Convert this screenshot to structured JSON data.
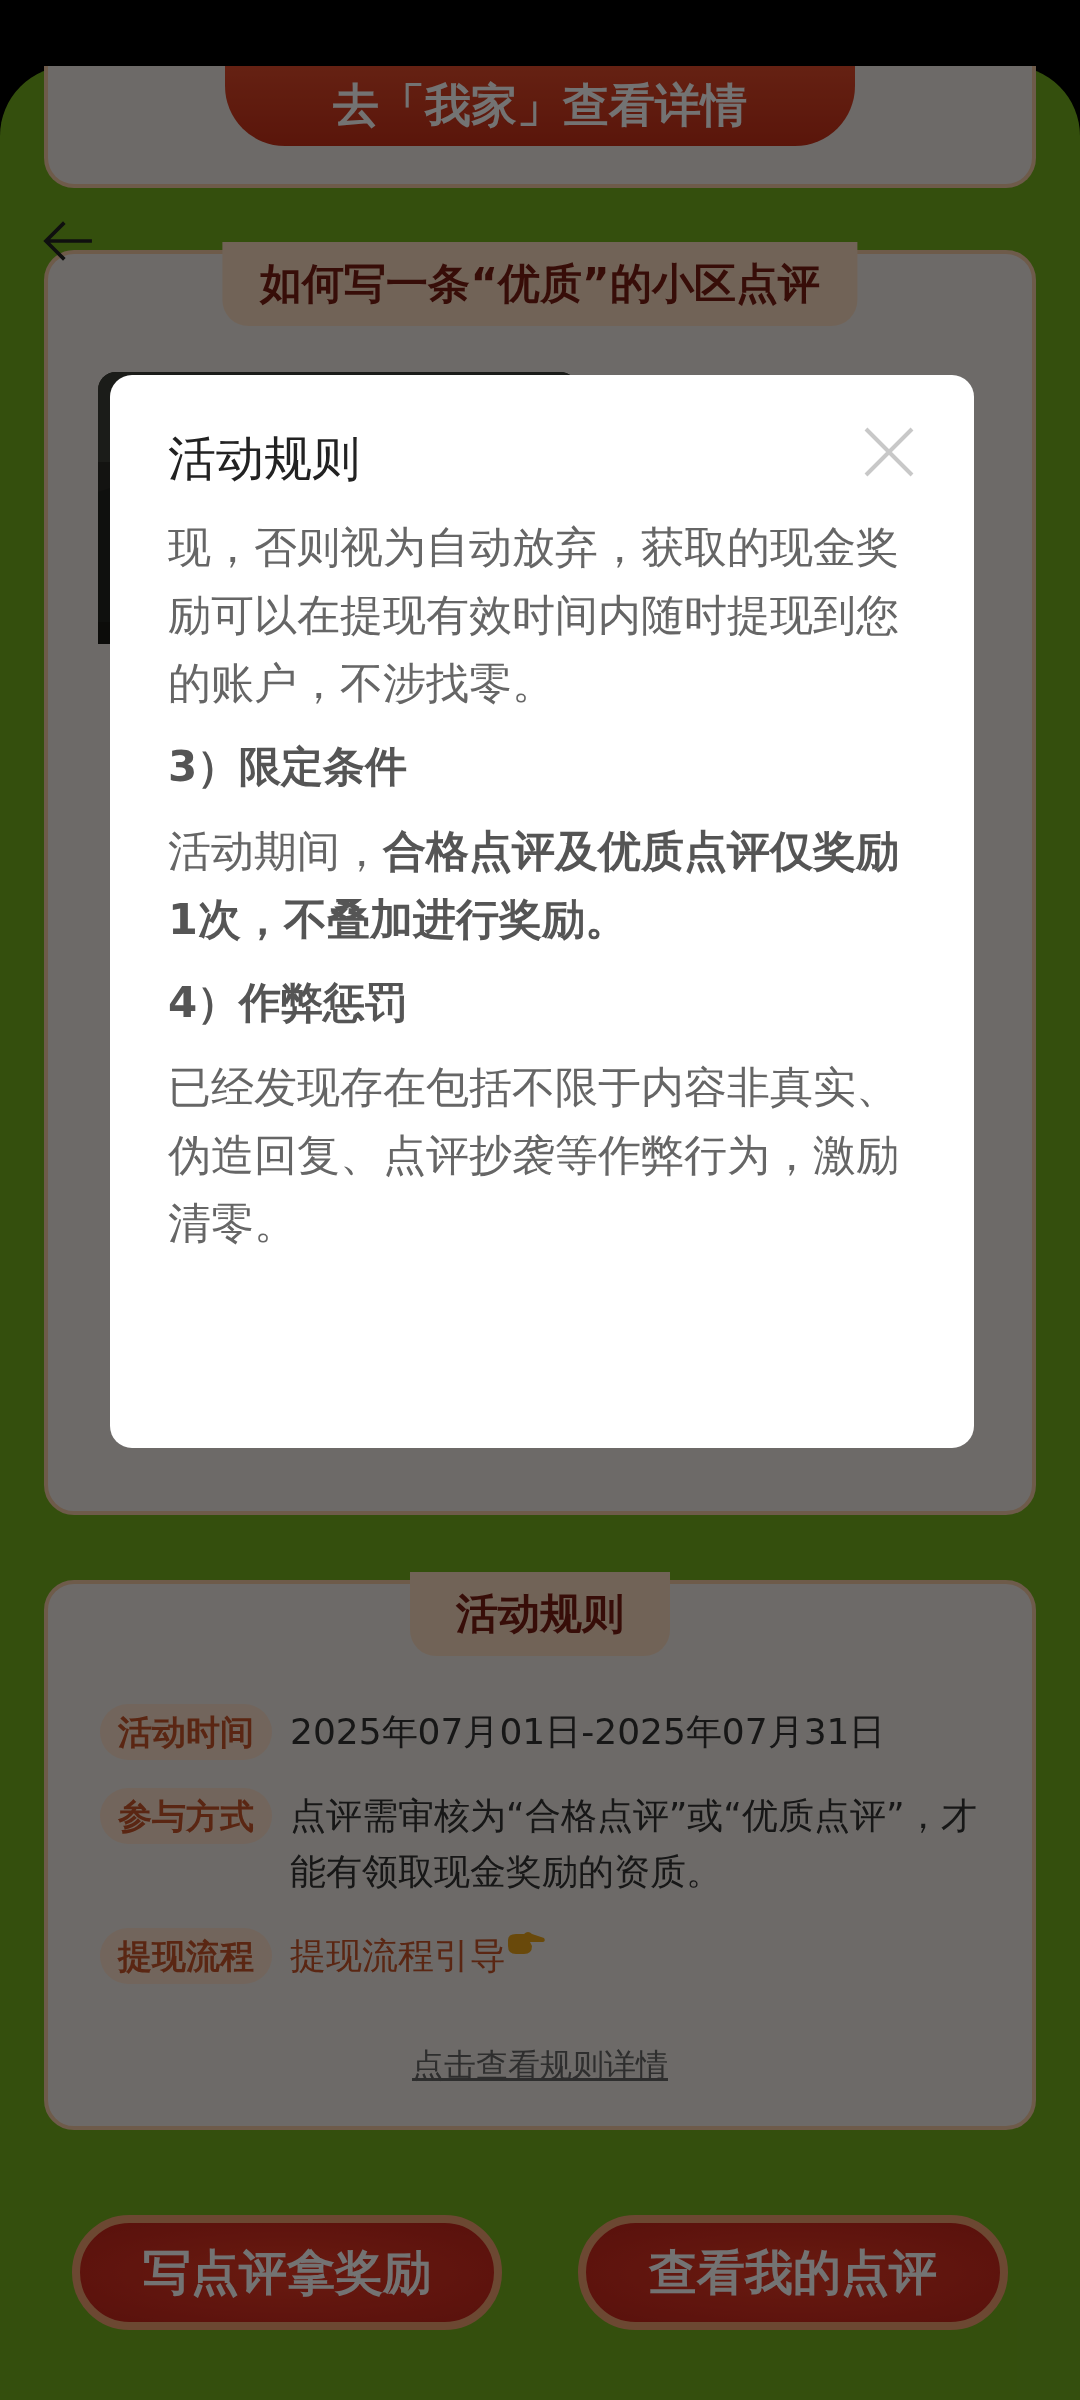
{
  "header_button": {
    "label": "去「我家」查看详情"
  },
  "guide_card": {
    "title": "如何写一条“优质”的小区点评"
  },
  "rules_card": {
    "title": "活动规则",
    "items": [
      {
        "tag": "活动时间",
        "text": "2025年07月01日-2025年07月31日",
        "kind": "plain"
      },
      {
        "tag": "参与方式",
        "text": "点评需审核为“合格点评”或“优质点评”，才能有领取现金奖励的资质。",
        "kind": "plain"
      },
      {
        "tag": "提现流程",
        "text": "提现流程引导",
        "kind": "link"
      }
    ],
    "details_link": "点击查看规则详情"
  },
  "buttons": [
    "写点评拿奖励",
    "查看我的点评"
  ],
  "modal": {
    "title": "活动规则",
    "blocks": [
      {
        "kind": "paragraph",
        "text": "现，否则视为自动放弃，获取的现金奖励可以在提现有效时间内随时提现到您的账户，不涉找零。"
      },
      {
        "kind": "heading",
        "text": "3）限定条件"
      },
      {
        "kind": "paragraph",
        "text": "活动期间，**合格点评及优质点评仅奖励1次，不叠加进行奖励。**"
      },
      {
        "kind": "heading",
        "text": "4）作弊惩罚"
      },
      {
        "kind": "paragraph",
        "text": "已经发现存在包括不限于内容非真实、伪造回复、点评抄袭等作弊行为，激励清零。"
      }
    ]
  }
}
